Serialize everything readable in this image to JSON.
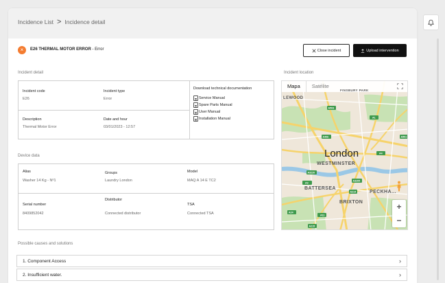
{
  "breadcrumb": {
    "root": "Incidence List",
    "separator": ">",
    "current": "Incidence detail"
  },
  "header": {
    "error_badge": "×",
    "code_title": "E26 THERMAL MOTOR ERROR",
    "status_suffix": " - Error",
    "close_button": "Close incident",
    "upload_button": "Upload intervention"
  },
  "incident_detail": {
    "section_label": "Incident detail",
    "code_label": "Incident code",
    "code_value": "E26",
    "type_label": "Incident type",
    "type_value": "Error",
    "description_label": "Description",
    "description_value": "Thermal Motor Error",
    "date_label": "Date and hour",
    "date_value": "03/01/2023 - 12:57",
    "docs_label": "Download technical documentation",
    "docs": [
      "Service Manual",
      "Spare Parts Manual",
      "User Manual",
      "Installation Manual"
    ]
  },
  "device_data": {
    "section_label": "Device data",
    "alias_label": "Alias",
    "alias_value": "Washer 14 Kg - Nº1",
    "groups_label": "Groups",
    "groups_value": "Laundry London",
    "model_label": "Model",
    "model_value": "MAQ A 14 E TC2",
    "serial_label": "Serial number",
    "serial_value": "8409852042",
    "distributor_label": "Distributor",
    "distributor_value": "Connected distributor",
    "tsa_label": "TSA",
    "tsa_value": "Connected TSA"
  },
  "location": {
    "section_label": "Incident location",
    "map_tab": "Mapa",
    "satellite_tab": "Satélite",
    "places": {
      "finsbury": "FINSBURY PARK",
      "lewood": "LEWOOD",
      "city": "London",
      "westminster": "WESTMINSTER",
      "battersea": "BATTERSEA",
      "peckham": "PECKHA...",
      "brixton": "BRIXTON"
    },
    "road_labels": [
      "A503",
      "A1",
      "A406",
      "A501",
      "A4",
      "A3220",
      "A3205",
      "A3",
      "A214",
      "A24",
      "A215",
      "A11"
    ],
    "zoom_in": "+",
    "zoom_out": "−"
  },
  "causes": {
    "section_label": "Possible causes and solutions",
    "items": [
      {
        "label": "1. Component Access"
      },
      {
        "label": "2. Insufficient water."
      }
    ]
  },
  "colors": {
    "accent_orange": "#f47c30",
    "dark_button": "#111111",
    "road_yellow": "#f6d36b",
    "park_green": "#c8e2b4",
    "river_blue": "#9bc8e6"
  }
}
